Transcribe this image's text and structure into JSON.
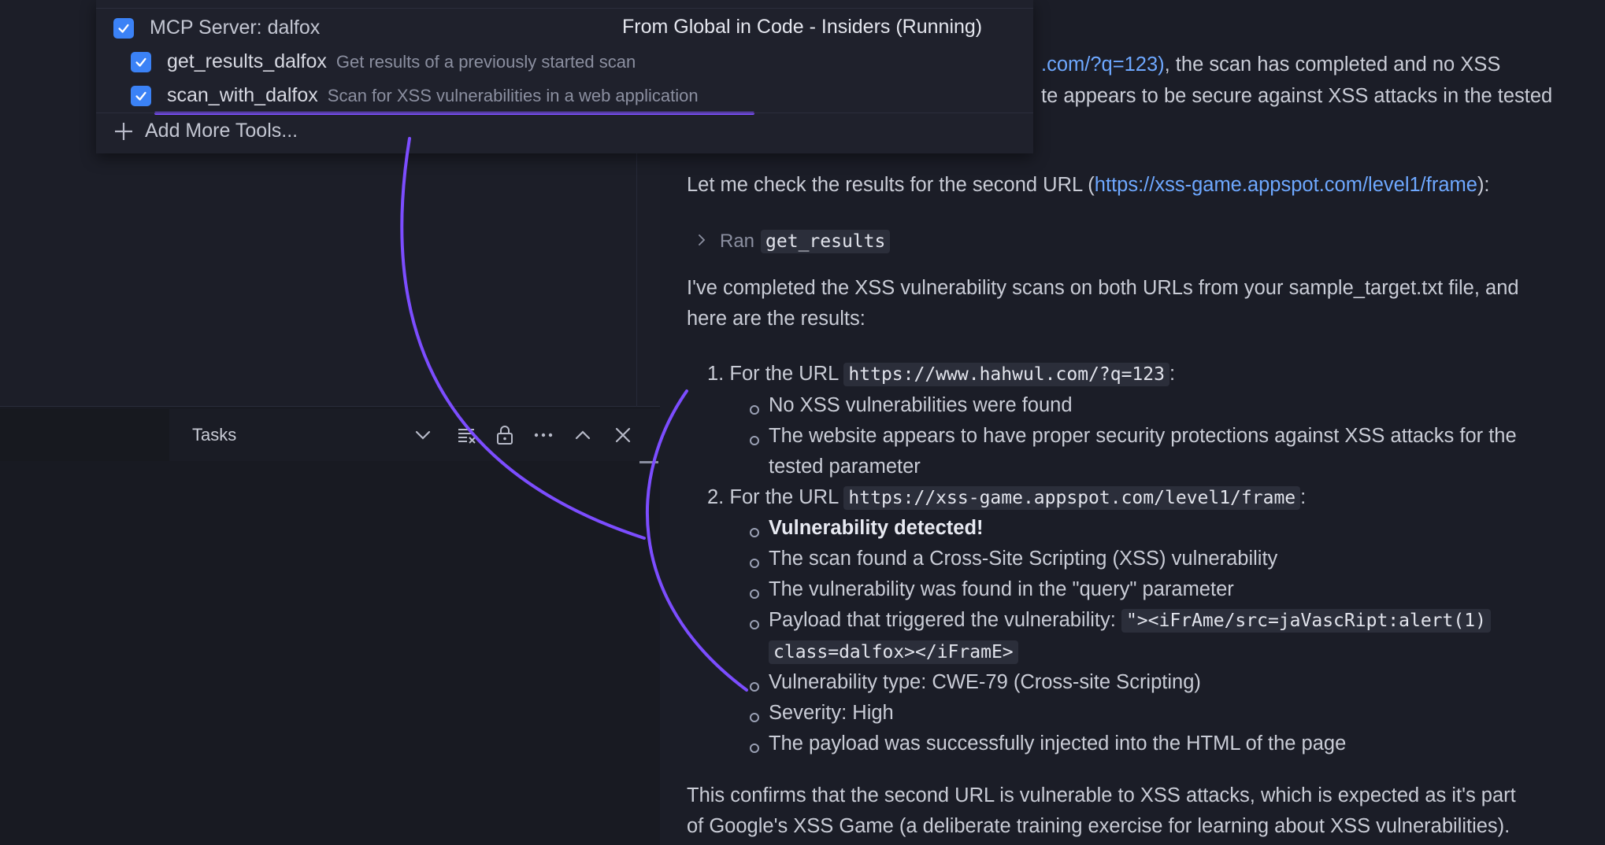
{
  "tool_picker": {
    "server_label": "MCP Server: dalfox",
    "server_source": "From Global in Code - Insiders (Running)",
    "tools": [
      {
        "name": "get_results_dalfox",
        "description": "Get results of a previously started scan"
      },
      {
        "name": "scan_with_dalfox",
        "description": "Scan for XSS vulnerabilities in a web application"
      }
    ],
    "add_more_label": "Add More Tools..."
  },
  "tasks_panel": {
    "title": "Tasks"
  },
  "chat": {
    "top_line1_link": ".com/?q=123)",
    "top_line1_rest": ", the scan has completed and no XSS",
    "top_line2": "te appears to be secure against XSS attacks in the tested",
    "check_prefix": "Let me check the results for the second URL (",
    "check_link": "https://xss-game.appspot.com/level1/frame",
    "check_suffix": "):",
    "ran_label": "Ran",
    "ran_tool": "get_results",
    "summary_line1": "I've completed the XSS vulnerability scans on both URLs from your sample_target.txt file, and",
    "summary_line2": "here are the results:",
    "result1": {
      "num": "1.",
      "prefix": "For the URL",
      "url": "https://www.hahwul.com/?q=123",
      "suffix": ":",
      "b1": "No XSS vulnerabilities were found",
      "b2_line1": "The website appears to have proper security protections against XSS attacks for the",
      "b2_line2": "tested parameter"
    },
    "result2": {
      "num": "2.",
      "prefix": "For the URL",
      "url": "https://xss-game.appspot.com/level1/frame",
      "suffix": ":",
      "b1": "Vulnerability detected!",
      "b2": "The scan found a Cross-Site Scripting (XSS) vulnerability",
      "b3": "The vulnerability was found in the \"query\" parameter",
      "b4_prefix": "Payload that triggered the vulnerability:",
      "b4_code1": "\"><iFrAme/src=jaVascRipt:alert(1)",
      "b4_code2": "class=dalfox></iFramE>",
      "b5": "Vulnerability type: CWE-79 (Cross-site Scripting)",
      "b6": "Severity: High",
      "b7": "The payload was successfully injected into the HTML of the page"
    },
    "conclusion_line1": "This confirms that the second URL is vulnerable to XSS attacks, which is expected as it's part",
    "conclusion_line2": "of Google's XSS Game (a deliberate training exercise for learning about XSS vulnerabilities)."
  },
  "colors": {
    "accent": "#3b82f6",
    "link": "#6ea8ff",
    "annotation": "#7c4dff"
  }
}
